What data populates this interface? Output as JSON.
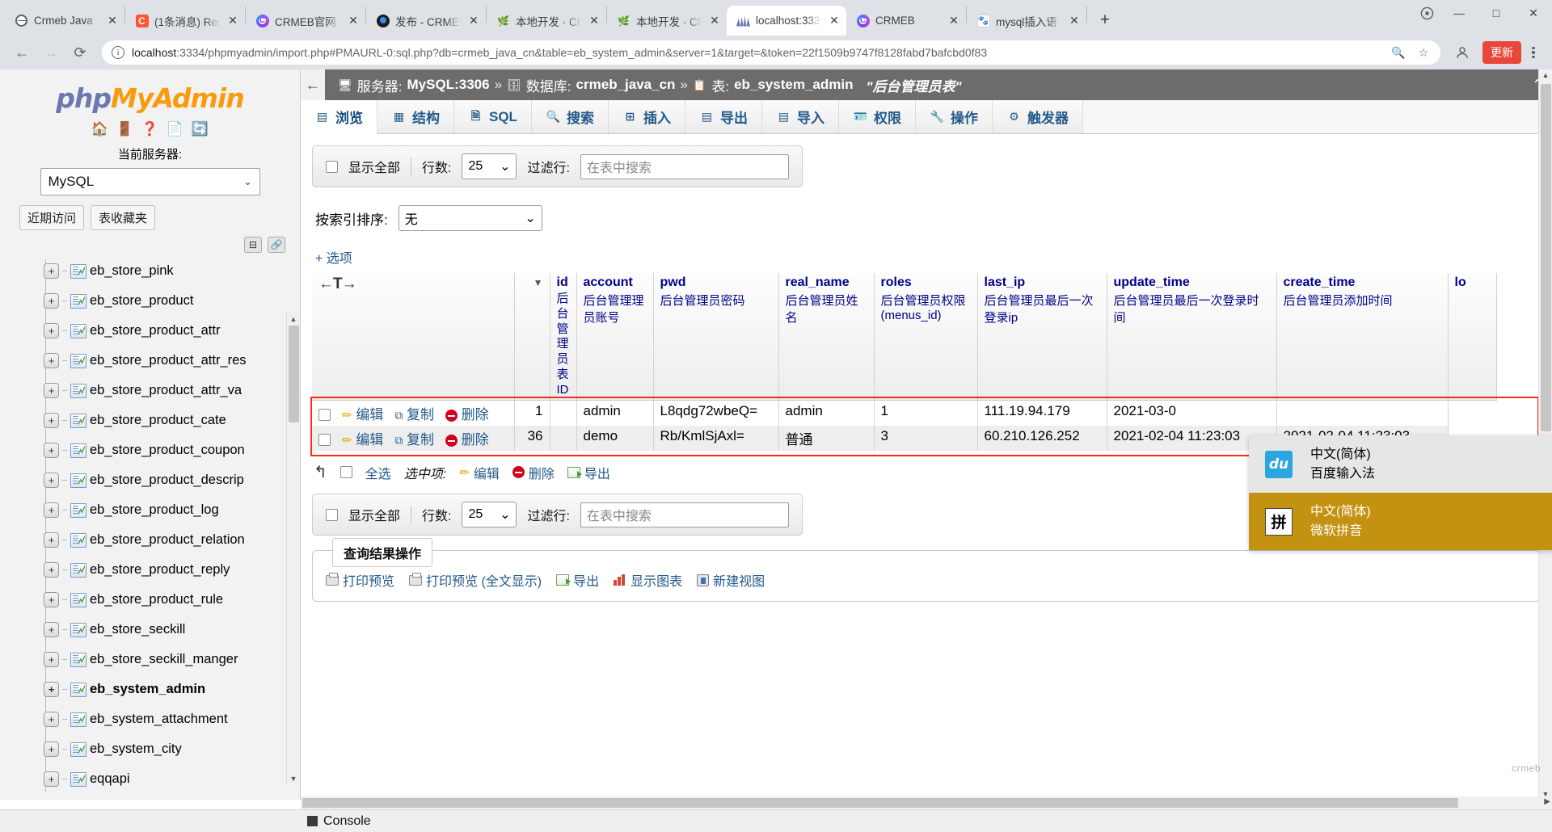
{
  "browser": {
    "tabs": [
      {
        "title": "Crmeb Java",
        "favicon": "globe-icon",
        "active": false
      },
      {
        "title": "(1条消息) Red",
        "favicon": "csdn-icon",
        "active": false
      },
      {
        "title": "CRMEB官网 -",
        "favicon": "crmeb-icon",
        "active": false
      },
      {
        "title": "发布 - CRMEB",
        "favicon": "qq-icon",
        "active": false
      },
      {
        "title": "本地开发 · CR",
        "favicon": "leaf-icon",
        "active": false
      },
      {
        "title": "本地开发 · CR",
        "favicon": "leaf-icon",
        "active": false
      },
      {
        "title": "localhost:333",
        "favicon": "phpmyadmin-icon",
        "active": true
      },
      {
        "title": "CRMEB",
        "favicon": "crmeb-icon",
        "active": false
      },
      {
        "title": "mysql插入语",
        "favicon": "baidu-icon",
        "active": false
      }
    ],
    "new_tab_label": "+",
    "window_controls": {
      "minimize": "—",
      "maximize": "□",
      "close": "✕"
    },
    "toolbar": {
      "back": "←",
      "forward": "→",
      "reload": "⟳",
      "url_host": "localhost",
      "url_rest": ":3334/phpmyadmin/import.php#PMAURL-0:sql.php?db=crmeb_java_cn&table=eb_system_admin&server=1&target=&token=22f1509b9747f8128fabd7bafcbd0f83",
      "zoom_icon": "search-plus-icon",
      "bookmark_icon": "star-icon",
      "profile_icon": "profile-icon",
      "update_label": "更新",
      "menu_icon": "kebab-menu-icon"
    }
  },
  "sidebar": {
    "logo": {
      "part1": "php",
      "part2": "MyAdmin"
    },
    "icons": [
      "home-icon",
      "logout-icon",
      "help-icon",
      "docs-icon",
      "reload-icon"
    ],
    "current_server_label": "当前服务器:",
    "server_value": "MySQL",
    "buttons": [
      "近期访问",
      "表收藏夹"
    ],
    "collapse_icon": "collapse-icon",
    "link_icon": "link-icon",
    "tables": [
      {
        "name": "eb_store_pink",
        "selected": false
      },
      {
        "name": "eb_store_product",
        "selected": false
      },
      {
        "name": "eb_store_product_attr",
        "selected": false
      },
      {
        "name": "eb_store_product_attr_res",
        "selected": false
      },
      {
        "name": "eb_store_product_attr_va",
        "selected": false
      },
      {
        "name": "eb_store_product_cate",
        "selected": false
      },
      {
        "name": "eb_store_product_coupon",
        "selected": false
      },
      {
        "name": "eb_store_product_descrip",
        "selected": false
      },
      {
        "name": "eb_store_product_log",
        "selected": false
      },
      {
        "name": "eb_store_product_relation",
        "selected": false
      },
      {
        "name": "eb_store_product_reply",
        "selected": false
      },
      {
        "name": "eb_store_product_rule",
        "selected": false
      },
      {
        "name": "eb_store_seckill",
        "selected": false
      },
      {
        "name": "eb_store_seckill_manger",
        "selected": false
      },
      {
        "name": "eb_system_admin",
        "selected": true
      },
      {
        "name": "eb_system_attachment",
        "selected": false
      },
      {
        "name": "eb_system_city",
        "selected": false
      },
      {
        "name": "eqqapi",
        "selected": false
      }
    ]
  },
  "main": {
    "breadcrumb": {
      "back_icon": "back-arrow-icon",
      "server_label": "服务器:",
      "server_name": "MySQL:3306",
      "sep": "»",
      "db_label": "数据库:",
      "db_name": "crmeb_java_cn",
      "table_label": "表:",
      "table_name": "eb_system_admin",
      "comment": "\"后台管理员表\"",
      "collapse_icon": "chevron-up-icon"
    },
    "tabs": [
      {
        "label": "浏览",
        "icon": "browse-icon",
        "active": true
      },
      {
        "label": "结构",
        "icon": "structure-icon",
        "active": false
      },
      {
        "label": "SQL",
        "icon": "sql-icon",
        "active": false
      },
      {
        "label": "搜索",
        "icon": "search-icon",
        "active": false
      },
      {
        "label": "插入",
        "icon": "insert-icon",
        "active": false
      },
      {
        "label": "导出",
        "icon": "export-icon",
        "active": false
      },
      {
        "label": "导入",
        "icon": "import-icon",
        "active": false
      },
      {
        "label": "权限",
        "icon": "privileges-icon",
        "active": false
      },
      {
        "label": "操作",
        "icon": "operations-icon",
        "active": false
      },
      {
        "label": "触发器",
        "icon": "triggers-icon",
        "active": false
      }
    ],
    "toolbar_top": {
      "show_all_label": "显示全部",
      "rows_label": "行数:",
      "rows_value": "25",
      "filter_label": "过滤行:",
      "filter_placeholder": "在表中搜索",
      "filter_value": ""
    },
    "sort_row": {
      "label": "按索引排序:",
      "value": "无"
    },
    "options_link": "+ 选项",
    "table": {
      "nav_arrows": "←T→",
      "sort_caret_icon": "caret-down-icon",
      "columns": [
        {
          "name": "id",
          "comment": "后台管理员表ID",
          "vertical": true
        },
        {
          "name": "account",
          "comment": "后台管理理员账号",
          "vertical": false
        },
        {
          "name": "pwd",
          "comment": "后台管理员密码",
          "vertical": false
        },
        {
          "name": "real_name",
          "comment": "后台管理员姓名",
          "vertical": false
        },
        {
          "name": "roles",
          "comment": "后台管理员权限 (menus_id)",
          "vertical": false
        },
        {
          "name": "last_ip",
          "comment": "后台管理员最后一次登录ip",
          "vertical": false
        },
        {
          "name": "update_time",
          "comment": "后台管理员最后一次登录时间",
          "vertical": false
        },
        {
          "name": "create_time",
          "comment": "后台管理员添加时间",
          "vertical": false
        },
        {
          "name": "lo",
          "comment": "",
          "vertical": false
        }
      ],
      "row_actions": {
        "edit": "编辑",
        "copy": "复制",
        "delete": "删除"
      },
      "rows": [
        {
          "id": "1",
          "account": "admin",
          "pwd": "L8qdg72wbeQ=",
          "real_name": "admin",
          "roles": "1",
          "last_ip": "111.19.94.179",
          "update_time": "2021-03-0",
          "create_time": ""
        },
        {
          "id": "36",
          "account": "demo",
          "pwd": "Rb/KmlSjAxl=",
          "real_name": "普通",
          "roles": "3",
          "last_ip": "60.210.126.252",
          "update_time": "2021-02-04 11:23:03",
          "create_time": "2021-02-04 11:23:03"
        }
      ]
    },
    "bottom_actions": {
      "up_arrow_icon": "arrow-up-icon",
      "select_all": "全选",
      "with_selected": "选中项:",
      "edit": "编辑",
      "delete": "删除",
      "export": "导出"
    },
    "toolbar_bottom": {
      "show_all_label": "显示全部",
      "rows_label": "行数:",
      "rows_value": "25",
      "filter_label": "过滤行:",
      "filter_placeholder": "在表中搜索",
      "filter_value": ""
    },
    "query_results": {
      "legend": "查询结果操作",
      "links": [
        {
          "label": "打印预览",
          "icon": "printer-icon"
        },
        {
          "label": "打印预览 (全文显示)",
          "icon": "printer-icon"
        },
        {
          "label": "导出",
          "icon": "export-icon"
        },
        {
          "label": "显示图表",
          "icon": "chart-icon"
        },
        {
          "label": "新建视图",
          "icon": "view-icon"
        }
      ]
    }
  },
  "ime_popup": {
    "items": [
      {
        "lang": "中文(简体)",
        "method": "百度输入法",
        "icon": "baidu-ime-icon",
        "icon_text": "du",
        "selected": false
      },
      {
        "lang": "中文(简体)",
        "method": "微软拼音",
        "icon": "pinyin-ime-icon",
        "icon_text": "拼",
        "selected": true
      }
    ]
  },
  "statusbar": {
    "console_label": "Console",
    "console_icon": "console-icon"
  },
  "watermark": "crmeb",
  "colors": {
    "accent": "#6c78af",
    "logo_orange": "#f89c0e",
    "highlight_red": "#ff2a1a",
    "ime_selected": "#c49211",
    "header_text": "#00008b"
  }
}
